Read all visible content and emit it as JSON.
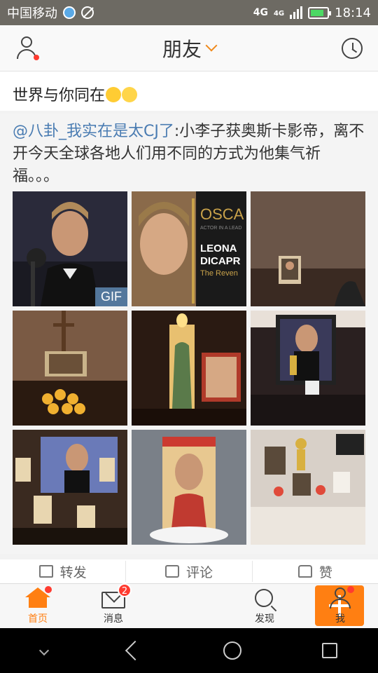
{
  "status_bar": {
    "carrier": "中国移动",
    "network": "4G",
    "network_small": "4G",
    "time": "18:14",
    "battery_fraction": 0.8
  },
  "header": {
    "title": "朋友"
  },
  "post": {
    "text": "世界与你同在"
  },
  "repost": {
    "mention": "@八卦_我实在是太CJ了",
    "text": ":小李子获奥斯卡影帝，离不开今天全球各地人们用不同的方式为他集气祈福。。。"
  },
  "images": {
    "gif_badge": "GIF",
    "poster_title": "OSCA",
    "poster_sub": "ACTOR IN A LEAD",
    "poster_name1": "LEONA",
    "poster_name2": "DICAPR",
    "poster_film": "The Reven"
  },
  "actions": {
    "repost": "转发",
    "comment": "评论",
    "like": "赞"
  },
  "tabs": {
    "home": "首页",
    "messages": "消息",
    "messages_badge": "2",
    "discover": "发现",
    "me": "我"
  },
  "colors": {
    "accent": "#ff7f12",
    "link": "#4a7cb2",
    "badge": "#ff3b30"
  }
}
